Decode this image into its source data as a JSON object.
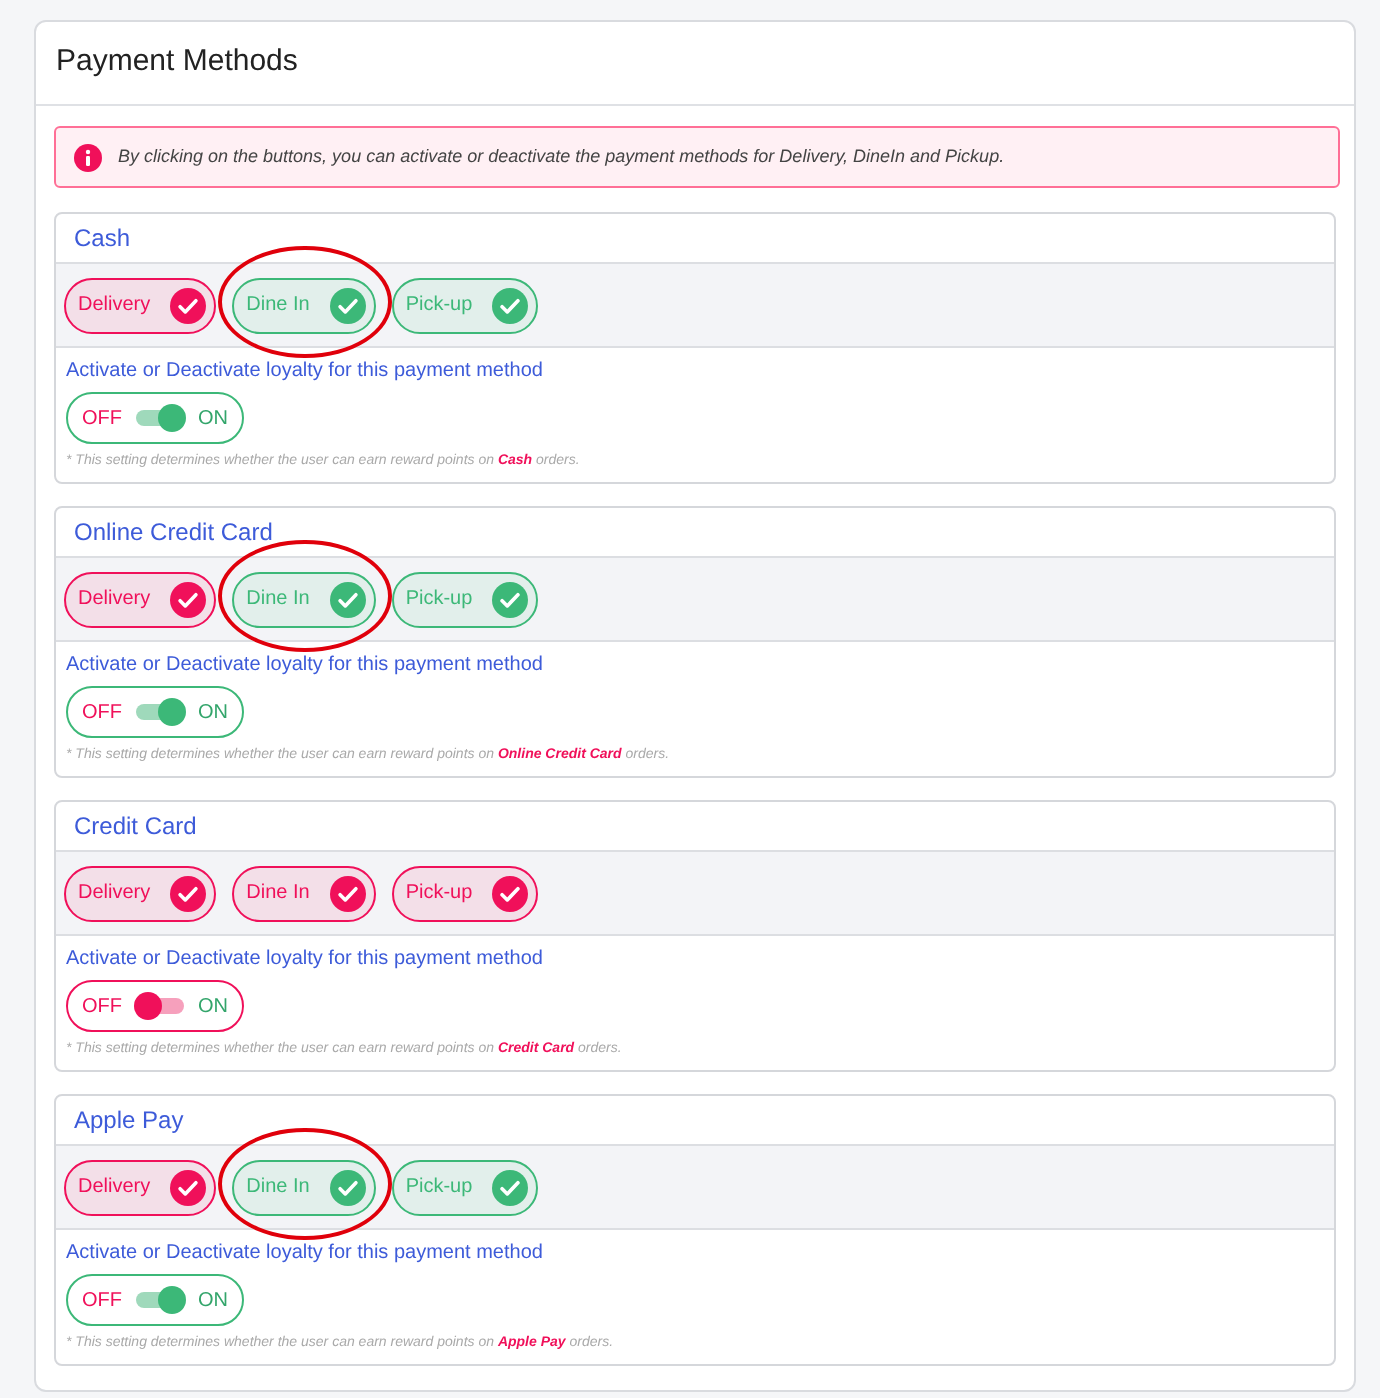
{
  "panel": {
    "title": "Payment Methods"
  },
  "alert": {
    "text": "By clicking on the buttons, you can activate or deactivate the payment methods for Delivery, DineIn and Pickup."
  },
  "methods": [
    {
      "name": "Cash",
      "services": [
        {
          "label": "Delivery",
          "color": "#f0105a",
          "circled": false
        },
        {
          "label": "Dine In",
          "color": "#3cb878",
          "circled": true
        },
        {
          "label": "Pick-up",
          "color": "#3cb878",
          "circled": false
        }
      ],
      "loyalty": {
        "label": "Activate or Deactivate loyalty for this payment method",
        "off_text": "OFF",
        "on_text": "ON",
        "on": true
      },
      "note": "* This setting determines whether the user can earn reward points on **Cash** orders."
    },
    {
      "name": "Online Credit Card",
      "services": [
        {
          "label": "Delivery",
          "color": "#f0105a",
          "circled": false
        },
        {
          "label": "Dine In",
          "color": "#3cb878",
          "circled": true
        },
        {
          "label": "Pick-up",
          "color": "#3cb878",
          "circled": false
        }
      ],
      "loyalty": {
        "label": "Activate or Deactivate loyalty for this payment method",
        "off_text": "OFF",
        "on_text": "ON",
        "on": true
      },
      "note": "* This setting determines whether the user can earn reward points on **Online Credit Card** orders."
    },
    {
      "name": "Credit Card",
      "services": [
        {
          "label": "Delivery",
          "color": "#f0105a",
          "circled": false
        },
        {
          "label": "Dine In",
          "color": "#f0105a",
          "circled": false
        },
        {
          "label": "Pick-up",
          "color": "#f0105a",
          "circled": false
        }
      ],
      "loyalty": {
        "label": "Activate or Deactivate loyalty for this payment method",
        "off_text": "OFF",
        "on_text": "ON",
        "on": false
      },
      "note": "* This setting determines whether the user can earn reward points on **Credit Card** orders."
    },
    {
      "name": "Apple Pay",
      "services": [
        {
          "label": "Delivery",
          "color": "#f0105a",
          "circled": false
        },
        {
          "label": "Dine In",
          "color": "#3cb878",
          "circled": true
        },
        {
          "label": "Pick-up",
          "color": "#3cb878",
          "circled": false
        }
      ],
      "loyalty": {
        "label": "Activate or Deactivate loyalty for this payment method",
        "off_text": "OFF",
        "on_text": "ON",
        "on": true
      },
      "note": "* This setting determines whether the user can earn reward points on **Apple Pay** orders."
    }
  ]
}
